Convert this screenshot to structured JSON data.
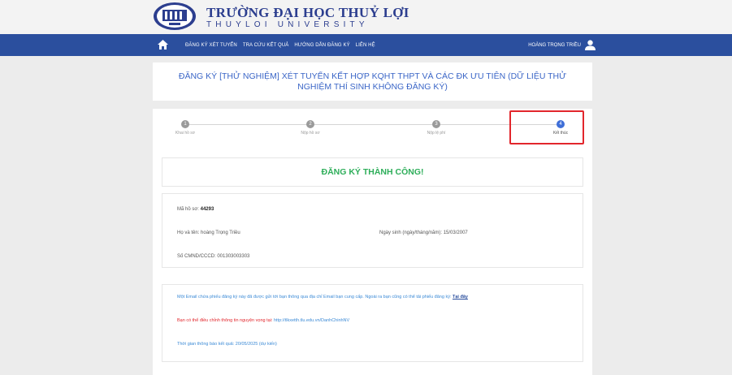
{
  "header": {
    "title": "TRƯỜNG ĐẠI HỌC THUỶ LỢI",
    "subtitle": "THUYLOI UNIVERSITY"
  },
  "nav": {
    "items": [
      "Đăng ký xét tuyển",
      "Tra cứu kết quả",
      "Hướng dẫn đăng ký",
      "Liên hệ"
    ],
    "user": "Hoàng Trọng Triều"
  },
  "page": {
    "title": "ĐĂNG KÝ [THỬ NGHIỆM] XÉT TUYỂN KẾT HỢP KQHT THPT VÀ CÁC ĐK ƯU TIÊN (DỮ LIỆU THỬ NGHIỆM THÍ SINH KHÔNG ĐĂNG KÝ)"
  },
  "stepper": {
    "steps": [
      {
        "num": "1",
        "label": "Khai hồ sơ"
      },
      {
        "num": "2",
        "label": "Nộp hồ sơ"
      },
      {
        "num": "3",
        "label": "Nộp lệ phí"
      },
      {
        "num": "4",
        "label": "Kết thúc"
      }
    ],
    "active_index": 3
  },
  "result": {
    "success": "ĐĂNG KÝ THÀNH CÔNG!",
    "profile_label": "Mã hồ sơ:",
    "profile_value": "44293",
    "name_label": "Họ và tên:",
    "name_value": "hoàng Trọng Triều",
    "dob_label": "Ngày sinh (ngày/tháng/năm):",
    "dob_value": "15/03/2007",
    "id_label": "Số CMND/CCCD:",
    "id_value": "001303003303"
  },
  "notes": {
    "email_text": "Một Email chứa phiếu đăng ký này đã được gửi tới bạn thông qua địa chỉ Email bạn cung cấp. Ngoài ra bạn cũng có thể tải phiếu đăng ký:",
    "email_link": "Tại đây",
    "adjust_text": "Bạn có thể điều chỉnh thông tin nguyện vọng tại:",
    "adjust_link": "http://tlkxetth.tlu.edu.vn/DanhChinhNV",
    "time_text": "Thời gian thông báo kết quả: 20/05/2025 (dự kiến)"
  },
  "colors": {
    "nav_bg": "#2b4f9e",
    "accent": "#3b66c7",
    "success": "#2eae5a",
    "highlight": "#e2262c"
  }
}
